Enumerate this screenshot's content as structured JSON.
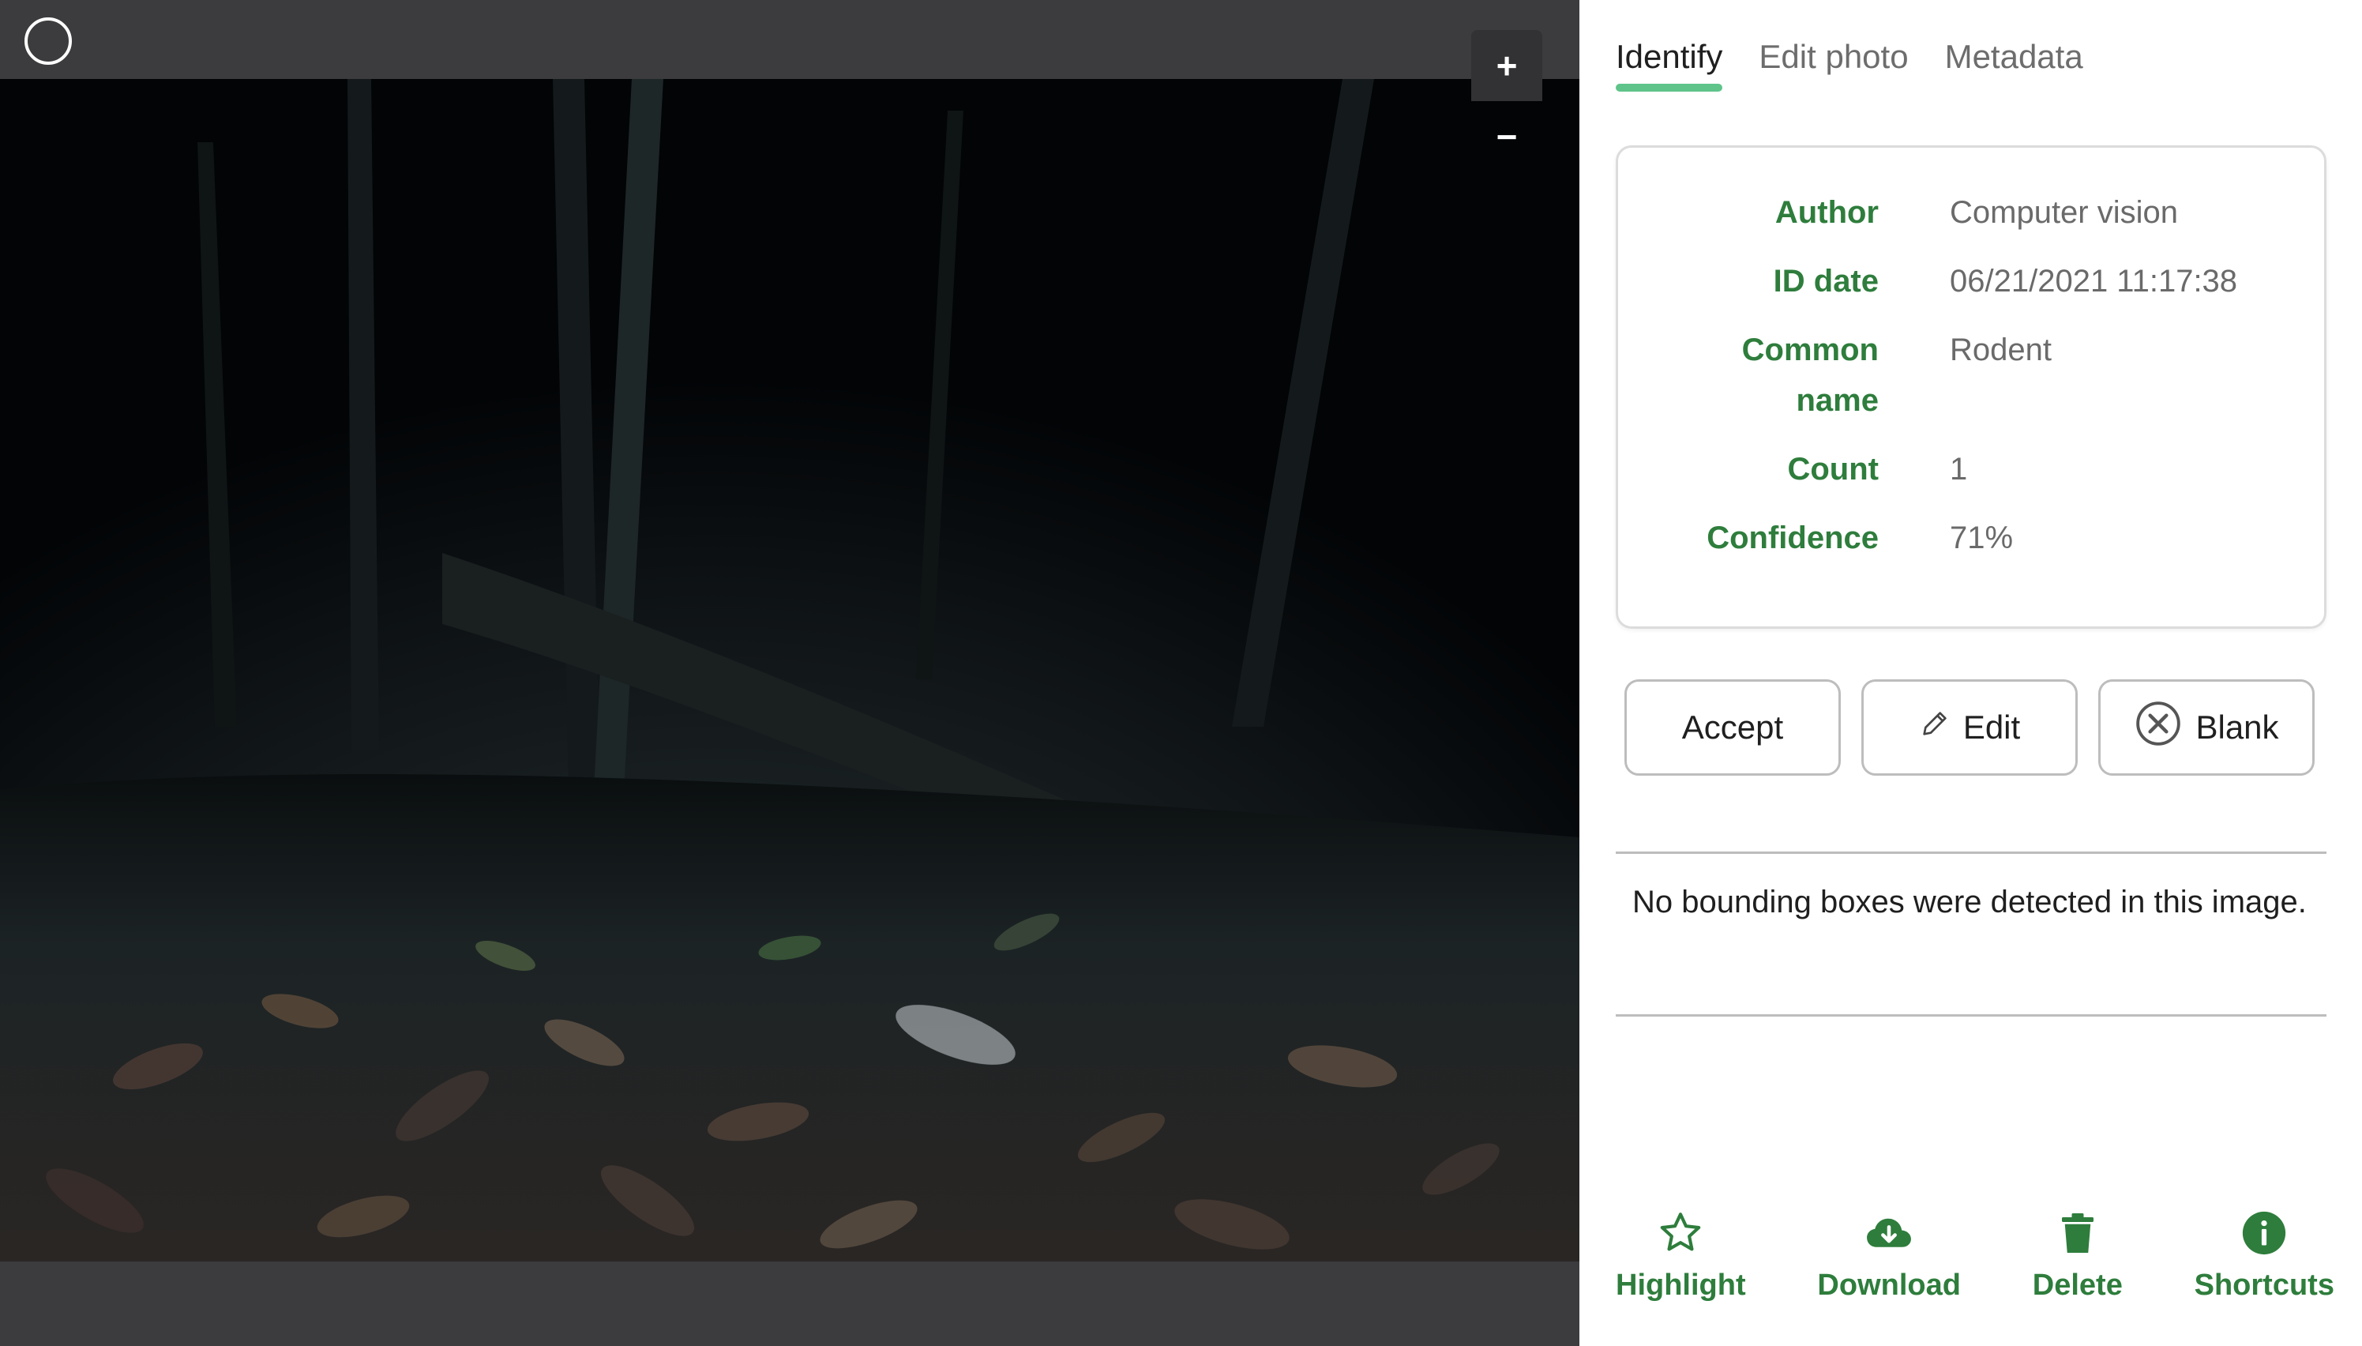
{
  "tabs": [
    {
      "label": "Identify",
      "active": true
    },
    {
      "label": "Edit photo",
      "active": false
    },
    {
      "label": "Metadata",
      "active": false
    }
  ],
  "zoom": {
    "in_label": "+",
    "out_label": "−"
  },
  "identification": {
    "author_label": "Author",
    "author_value": "Computer vision",
    "id_date_label": "ID date",
    "id_date_value": "06/21/2021 11:17:38",
    "common_name_label_line1": "Common",
    "common_name_label_line2": "name",
    "common_name_value": "Rodent",
    "count_label": "Count",
    "count_value": "1",
    "confidence_label": "Confidence",
    "confidence_value": "71%"
  },
  "actions": {
    "accept": "Accept",
    "edit": "Edit",
    "blank": "Blank"
  },
  "detection_message": "No bounding boxes were detected in this image.",
  "bottom_bar": {
    "highlight": "Highlight",
    "download": "Download",
    "delete": "Delete",
    "shortcuts": "Shortcuts"
  },
  "colors": {
    "accent_green": "#2e7d3c",
    "tab_underline": "#5fc48a",
    "viewer_background": "#3c3c3e"
  },
  "icons": [
    "select-circle-icon",
    "pencil-icon",
    "close-circle-icon",
    "star-icon",
    "cloud-download-icon",
    "trash-icon",
    "info-icon"
  ]
}
